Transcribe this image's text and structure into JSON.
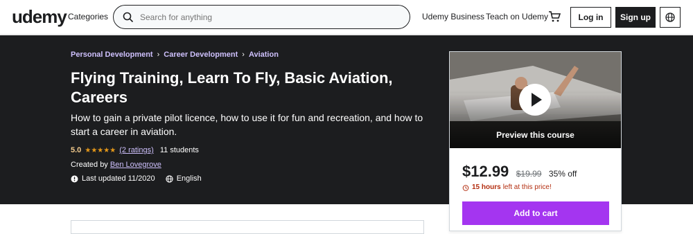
{
  "header": {
    "logo": "udemy",
    "categories": "Categories",
    "search_placeholder": "Search for anything",
    "udemy_business": "Udemy Business",
    "teach": "Teach on Udemy",
    "login": "Log in",
    "signup": "Sign up"
  },
  "breadcrumb": [
    "Personal Development",
    "Career Development",
    "Aviation"
  ],
  "course": {
    "title": "Flying Training, Learn To Fly, Basic Aviation, Careers",
    "subtitle": "How to gain a private pilot licence, how to use it for fun and recreation, and how to start a career in aviation.",
    "rating": "5.0",
    "stars": "★★★★★",
    "ratings_count": "(2 ratings)",
    "students": "11 students",
    "created_by_label": "Created by",
    "instructor": "Ben Lovegrove",
    "last_updated": "Last updated 11/2020",
    "language": "English"
  },
  "card": {
    "preview_label": "Preview this course",
    "price": "$12.99",
    "original_price": "$19.99",
    "discount": "35% off",
    "timer_hours": "15 hours",
    "timer_text": "left at this price!",
    "add_to_cart": "Add to cart"
  },
  "colors": {
    "accent": "#a435f0",
    "hero_bg": "#1c1d1f",
    "link_purple": "#cec0fc",
    "rating": "#f3ca8c",
    "warning": "#b32d0f"
  }
}
